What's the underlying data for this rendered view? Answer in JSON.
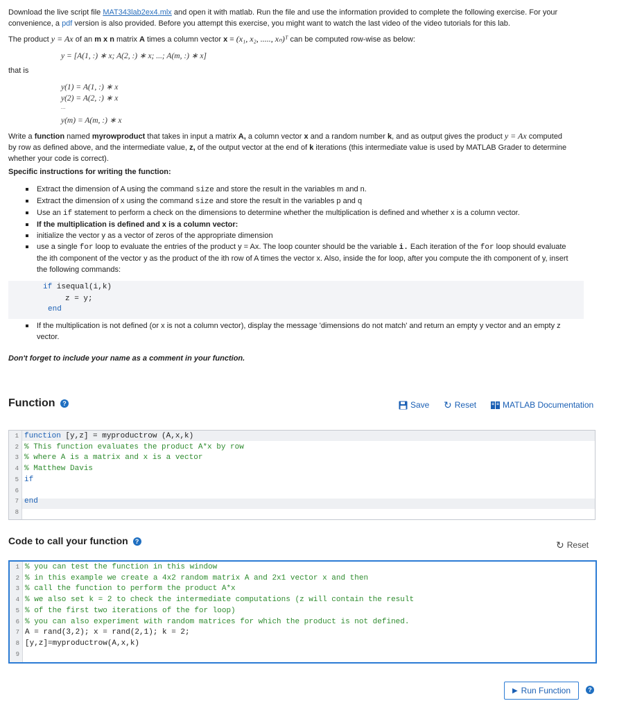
{
  "intro": {
    "t1": "Download the live script file ",
    "file_link": "MAT343lab2ex4.mlx",
    "t2": " and open it with matlab. Run the file and use the information provided to complete the following exercise. For your convenience, a ",
    "pdf_link": "pdf",
    "t3": " version is also provided. Before you attempt this exercise, you might want to watch the last video of the video tutorials for this lab."
  },
  "product": {
    "t1": "The product ",
    "m1": "y = Ax",
    "t2": " of an ",
    "b1": "m x n",
    "t3": " matrix ",
    "b2": "A",
    "t4": " times a column vector ",
    "b3": "x",
    "t5": " = ",
    "m2": "(x₁, x₂, ....., xₙ)ᵀ",
    "t6": " can be computed row-wise as below:",
    "formula": "y = [A(1, :) ∗ x; A(2, :) ∗ x; ...; A(m, :) ∗ x]"
  },
  "thatis": "that is",
  "eqs": [
    "y(1) = A(1, :) ∗ x",
    "y(2) = A(2, :) ∗ x",
    "...",
    "y(m) = A(m, :) ∗ x"
  ],
  "write": {
    "t1": "Write a ",
    "b1": "function",
    "t2": " named ",
    "b2": "myrowproduct",
    "t3": " that takes in input a matrix ",
    "b3": "A,",
    "t4": " a column vector ",
    "b4": "x",
    "t5": " and a random number ",
    "b5": "k",
    "t6": ", and as output gives the product ",
    "m1": "y = Ax",
    "t7": " computed by row as defined above, and the intermediate value, ",
    "b6": "z,",
    "t8": "  of the output vector at the end of ",
    "b7": "k",
    "t9": " iterations (this intermediate value is used by MATLAB Grader to determine whether your code is correct)."
  },
  "specific_heading": "Specific instructions for writing the function:",
  "bullets": {
    "b1": {
      "t1": "Extract the dimension of A using the command ",
      "c1": "size",
      "t2": "  and store the result in the variables m and n."
    },
    "b2": {
      "t1": "Extract the dimension of x  using the command ",
      "c1": "size",
      "t2": "  and store the result in the variables p and q"
    },
    "b3": {
      "t1": "Use an ",
      "c1": "if",
      "t2": " statement to perform a check on the dimensions to determine whether the multiplication is defined and whether x is a column vector."
    },
    "b4": {
      "t1": "If the multiplication is defined and x is a column vector:"
    },
    "b5": {
      "t1": "initialize the vector y  as a vector of zeros of the appropriate dimension"
    },
    "b6": {
      "t1": "use a single ",
      "c1": "for",
      "t2": " loop to evaluate the entries of the product y = Ax.  The loop counter should be the variable ",
      "c2": " i.",
      "t3": " Each iteration of the ",
      "c3": "for",
      "t4": " loop  should evaluate the ith component of the vector y as the product of the ith row of A times the vector  x. Also, inside the for loop, after you compute the ith component of y, insert the following commands:"
    },
    "b7": {
      "t1": "If the multiplication is not defined (or x is not a column vector), display the message 'dimensions do not match' and return an empty y vector and an empty z vector."
    }
  },
  "snippet": {
    "l1_kw": "if",
    "l1_rest": " isequal(i,k)",
    "l2": "z = y;",
    "l3_kw": "end"
  },
  "reminder": "Don't forget to include your name as a comment in your function.",
  "function_section": {
    "title": "Function",
    "save": "Save",
    "reset": "Reset",
    "docs": "MATLAB Documentation",
    "lines": [
      {
        "n": "1",
        "kw": "function",
        "rest": " [y,z] = myproductrow (A,x,k)",
        "cm": ""
      },
      {
        "n": "2",
        "kw": "",
        "rest": "",
        "cm": "% This function evaluates the product A*x by row"
      },
      {
        "n": "3",
        "kw": "",
        "rest": "",
        "cm": "% where A is a matrix and x is a vector"
      },
      {
        "n": "4",
        "kw": "",
        "rest": "",
        "cm": "% Matthew Davis"
      },
      {
        "n": "5",
        "kw": "if",
        "rest": "",
        "cm": ""
      },
      {
        "n": "6",
        "kw": "",
        "rest": "",
        "cm": ""
      },
      {
        "n": "7",
        "kw": "end",
        "rest": "",
        "cm": ""
      },
      {
        "n": "8",
        "kw": "",
        "rest": "",
        "cm": ""
      }
    ]
  },
  "call_section": {
    "title": "Code to call your function",
    "reset": "Reset",
    "lines": [
      {
        "n": "1",
        "code": "",
        "cm": "% you can test the function in this window"
      },
      {
        "n": "2",
        "code": "",
        "cm": "% in this example we create a 4x2 random matrix A and 2x1 vector x and then"
      },
      {
        "n": "3",
        "code": "",
        "cm": "% call the function to perform the product A*x"
      },
      {
        "n": "4",
        "code": "",
        "cm": "% we also set k = 2 to check the intermediate computations (z will contain the result"
      },
      {
        "n": "5",
        "code": "",
        "cm": "% of the first two iterations of the for loop)"
      },
      {
        "n": "6",
        "code": "",
        "cm": "% you can also experiment with random matrices for which the product is not defined."
      },
      {
        "n": "7",
        "code": "A = rand(3,2); x = rand(2,1); k = 2;",
        "cm": ""
      },
      {
        "n": "8",
        "code": "[y,z]=myproductrow(A,x,k)",
        "cm": ""
      },
      {
        "n": "9",
        "code": "",
        "cm": ""
      }
    ],
    "run": "Run Function"
  },
  "colors": {
    "accent": "#1a5fb4",
    "comment": "#2e8b2e",
    "editor_border": "#2b7bd4"
  }
}
